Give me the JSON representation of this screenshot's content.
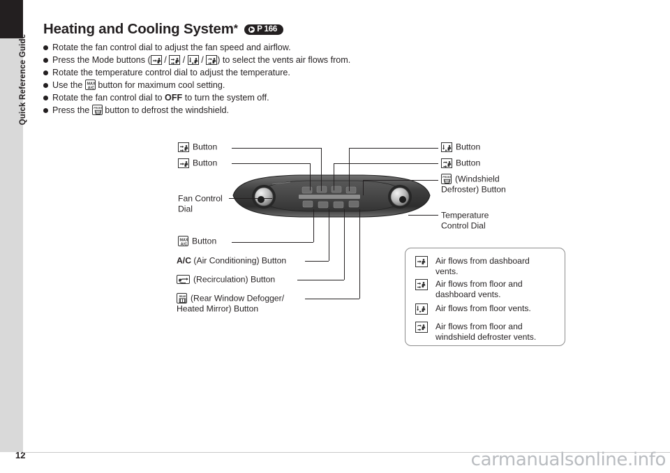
{
  "sidebar": {
    "label": "Quick Reference Guide",
    "page_number": "12"
  },
  "watermark": "carmanualsonline.info",
  "heading": {
    "title": "Heating and Cooling System",
    "star": "*",
    "page_ref": "P 166"
  },
  "bullets": [
    {
      "id": "fan-dial",
      "parts": [
        {
          "type": "text",
          "value": "Rotate the fan control dial to adjust the fan speed and airflow."
        }
      ]
    },
    {
      "id": "mode-buttons",
      "parts": [
        {
          "type": "text",
          "value": "Press the Mode buttons ("
        },
        {
          "type": "icon",
          "value": "mode-dashboard-vent-icon"
        },
        {
          "type": "text",
          "value": " / "
        },
        {
          "type": "icon",
          "value": "mode-floor-dashboard-vent-icon"
        },
        {
          "type": "text",
          "value": " / "
        },
        {
          "type": "icon",
          "value": "mode-floor-vent-icon"
        },
        {
          "type": "text",
          "value": " / "
        },
        {
          "type": "icon",
          "value": "mode-floor-defroster-vent-icon"
        },
        {
          "type": "text",
          "value": ") to select the vents air flows from."
        }
      ]
    },
    {
      "id": "temp-dial",
      "parts": [
        {
          "type": "text",
          "value": "Rotate the temperature control dial to adjust the temperature."
        }
      ]
    },
    {
      "id": "max-ac",
      "parts": [
        {
          "type": "text",
          "value": "Use the "
        },
        {
          "type": "icon",
          "value": "max-ac-icon"
        },
        {
          "type": "text",
          "value": " button for maximum cool setting."
        }
      ]
    },
    {
      "id": "fan-off",
      "parts": [
        {
          "type": "text",
          "value": "Rotate the fan control dial to "
        },
        {
          "type": "bold",
          "value": "OFF"
        },
        {
          "type": "text",
          "value": " to turn the system off."
        }
      ]
    },
    {
      "id": "defrost",
      "parts": [
        {
          "type": "text",
          "value": "Press the "
        },
        {
          "type": "icon",
          "value": "front-defroster-icon"
        },
        {
          "type": "text",
          "value": " button to defrost the windshield."
        }
      ]
    }
  ],
  "callouts": {
    "left": [
      {
        "id": "mode-floor-dashboard-button",
        "icon": "mode-floor-dashboard-vent-icon",
        "label": "Button"
      },
      {
        "id": "mode-dashboard-button",
        "icon": "mode-dashboard-vent-icon",
        "label": "Button"
      },
      {
        "id": "fan-control-dial",
        "icon": null,
        "label": "Fan Control\nDial"
      },
      {
        "id": "max-ac-button",
        "icon": "max-ac-icon",
        "label": "Button"
      },
      {
        "id": "ac-button",
        "icon": null,
        "label_bold": "A/C",
        "label": " (Air Conditioning) Button"
      },
      {
        "id": "recirculation-button",
        "icon": "recirculation-icon",
        "label": "(Recirculation) Button"
      },
      {
        "id": "rear-defogger-button",
        "icon": "rear-defogger-icon",
        "label": "(Rear Window Defogger/\nHeated Mirror) Button"
      }
    ],
    "right": [
      {
        "id": "mode-floor-button",
        "icon": "mode-floor-vent-icon",
        "label": "Button"
      },
      {
        "id": "mode-floor-defroster-button",
        "icon": "mode-floor-defroster-vent-icon",
        "label": "Button"
      },
      {
        "id": "windshield-defroster-button",
        "icon": "front-defroster-icon",
        "label": "(Windshield\nDefroster) Button"
      },
      {
        "id": "temperature-control-dial",
        "icon": null,
        "label": "Temperature\nControl Dial"
      }
    ]
  },
  "legend": [
    {
      "icon": "mode-dashboard-vent-icon",
      "text": "Air flows from dashboard\nvents."
    },
    {
      "icon": "mode-floor-dashboard-vent-icon",
      "text": "Air flows from floor and\ndashboard vents."
    },
    {
      "icon": "mode-floor-vent-icon",
      "text": "Air flows from floor vents."
    },
    {
      "icon": "mode-floor-defroster-vent-icon",
      "text": "Air flows from floor and\nwindshield defroster vents."
    }
  ],
  "colors": {
    "text": "#231f20",
    "sidebar": "#d9d9d9",
    "sidebar_accent": "#231f20",
    "panel_dark": "#4a4a4a",
    "panel_light": "#bfbfbf",
    "legend_border": "#8c8c8c",
    "watermark": "#b9bcc0"
  }
}
